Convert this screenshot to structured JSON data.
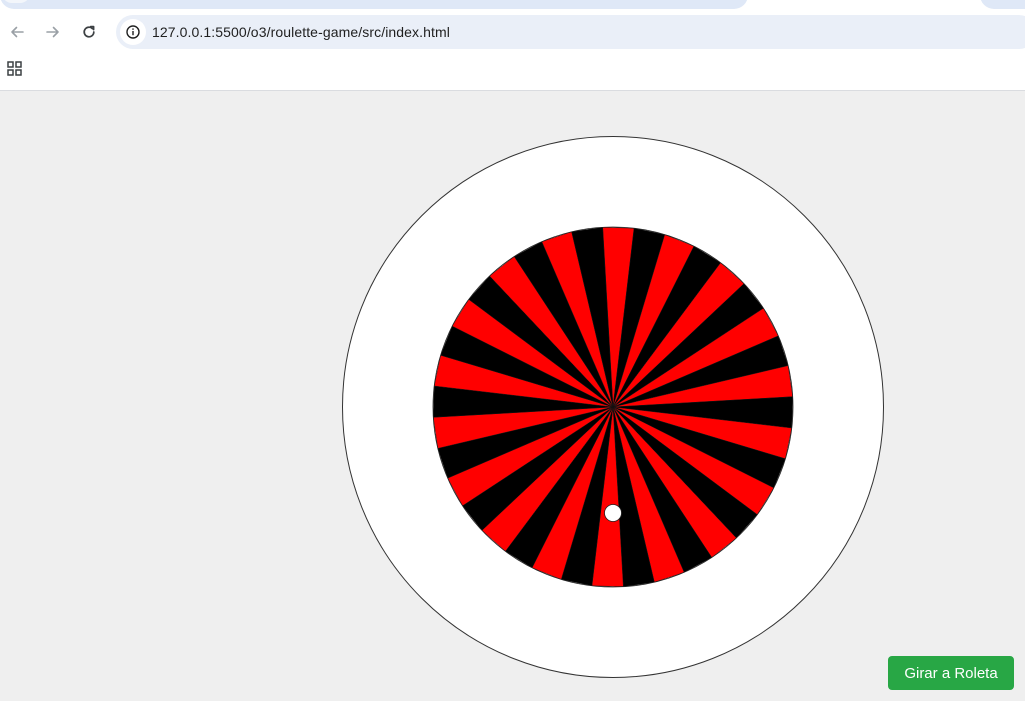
{
  "browser": {
    "url": "127.0.0.1:5500/o3/roulette-game/src/index.html",
    "icons": {
      "back": "arrow-left-icon",
      "forward": "arrow-right-icon",
      "reload": "reload-icon",
      "site_info": "info-icon",
      "apps": "apps-grid-icon"
    }
  },
  "roulette": {
    "segments": 36,
    "colors": [
      "#ff0000",
      "#000000"
    ],
    "outer_ring_color": "#ffffff",
    "ball_color": "#ffffff"
  },
  "controls": {
    "spin_label": "Girar a Roleta",
    "spin_color": "#28a745"
  }
}
